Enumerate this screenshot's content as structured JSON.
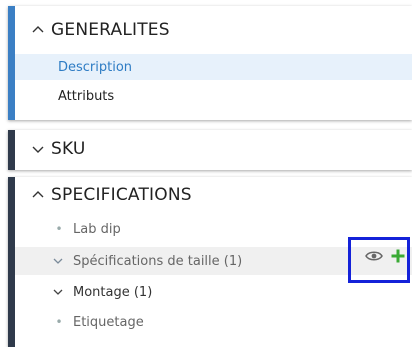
{
  "sections": {
    "general": {
      "title": "GENERALITES",
      "items": [
        {
          "label": "Description"
        },
        {
          "label": "Attributs"
        }
      ]
    },
    "sku": {
      "title": "SKU"
    },
    "specifications": {
      "title": "SPECIFICATIONS",
      "items": [
        {
          "label": "Lab dip"
        },
        {
          "label": "Spécifications de taille (1)"
        },
        {
          "label": "Montage (1)"
        },
        {
          "label": "Etiquetage"
        }
      ]
    }
  },
  "colors": {
    "accent_blue": "#3b7fc4",
    "dark_bar": "#2f3a4b",
    "selected_bg": "#e7f1fb",
    "add_green": "#3aaa35",
    "highlight_box": "#1422d9"
  },
  "icons": {
    "expand": "chevron-up-icon",
    "collapse": "chevron-down-icon",
    "view": "eye-icon",
    "add": "plus-icon"
  }
}
